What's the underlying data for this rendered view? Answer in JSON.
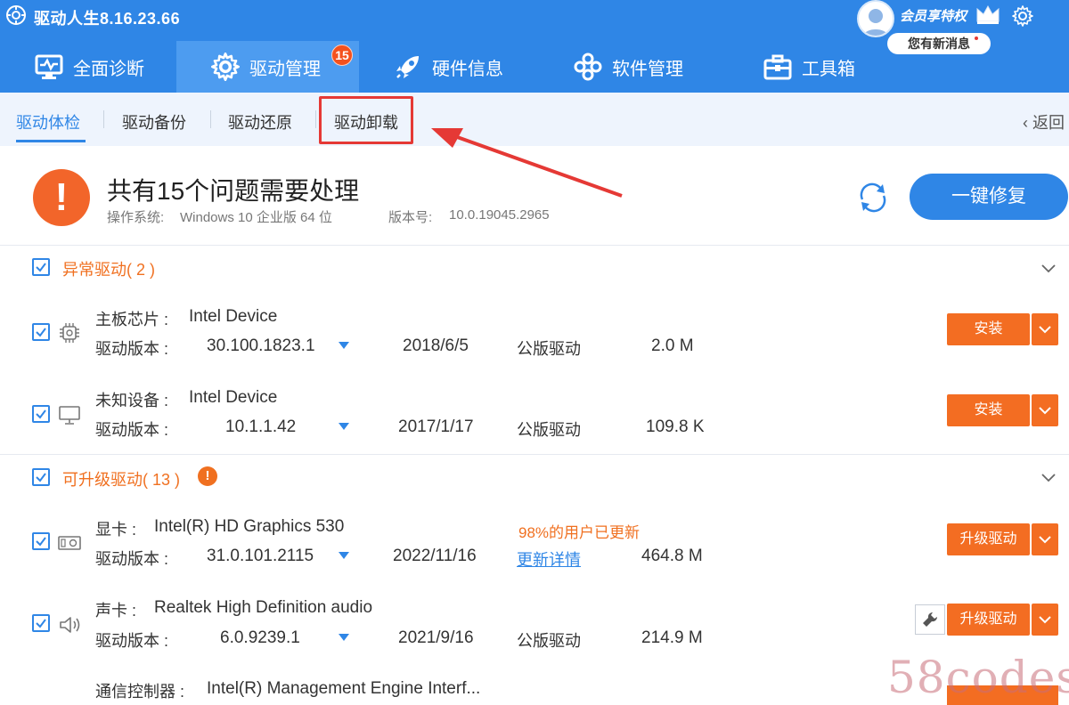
{
  "app": {
    "title": "驱动人生8.16.23.66"
  },
  "user": {
    "vip_label": "会员享特权",
    "message_label": "您有新消息"
  },
  "nav": {
    "tabs": [
      {
        "label": "全面诊断"
      },
      {
        "label": "驱动管理",
        "badge": "15"
      },
      {
        "label": "硬件信息"
      },
      {
        "label": "软件管理"
      },
      {
        "label": "工具箱"
      }
    ]
  },
  "subtabs": {
    "items": [
      {
        "label": "驱动体检"
      },
      {
        "label": "驱动备份"
      },
      {
        "label": "驱动还原"
      },
      {
        "label": "驱动卸载"
      }
    ],
    "back_label": "返回"
  },
  "summary": {
    "title": "共有15个问题需要处理",
    "os_label": "操作系统:",
    "os_value": "Windows 10 企业版 64 位",
    "version_label": "版本号:",
    "version_value": "10.0.19045.2965",
    "fix_button": "一键修复"
  },
  "sections": {
    "abnormal": {
      "title": "异常驱动( 2 )",
      "items": [
        {
          "category": "主板芯片 :",
          "device": "Intel Device",
          "version_label": "驱动版本 :",
          "version": "30.100.1823.1",
          "date": "2018/6/5",
          "type": "公版驱动",
          "size": "2.0 M",
          "action": "安装"
        },
        {
          "category": "未知设备 :",
          "device": "Intel Device",
          "version_label": "驱动版本 :",
          "version": "10.1.1.42",
          "date": "2017/1/17",
          "type": "公版驱动",
          "size": "109.8 K",
          "action": "安装"
        }
      ]
    },
    "upgradable": {
      "title": "可升级驱动( 13 )",
      "items": [
        {
          "category": "显卡 :",
          "device": "Intel(R) HD Graphics 530",
          "version_label": "驱动版本 :",
          "version": "31.0.101.2115",
          "date": "2022/11/16",
          "hint": "98%的用户已更新",
          "link": "更新详情",
          "size": "464.8 M",
          "action": "升级驱动"
        },
        {
          "category": "声卡 :",
          "device": "Realtek High Definition audio",
          "version_label": "驱动版本 :",
          "version": "6.0.9239.1",
          "date": "2021/9/16",
          "type": "公版驱动",
          "size": "214.9 M",
          "action": "升级驱动"
        },
        {
          "category": "通信控制器 :",
          "device": "Intel(R) Management Engine Interf..."
        }
      ]
    }
  },
  "watermark": "58codes",
  "colors": {
    "primary": "#2f86e6",
    "accent": "#f36d22",
    "highlight": "#e53935"
  }
}
